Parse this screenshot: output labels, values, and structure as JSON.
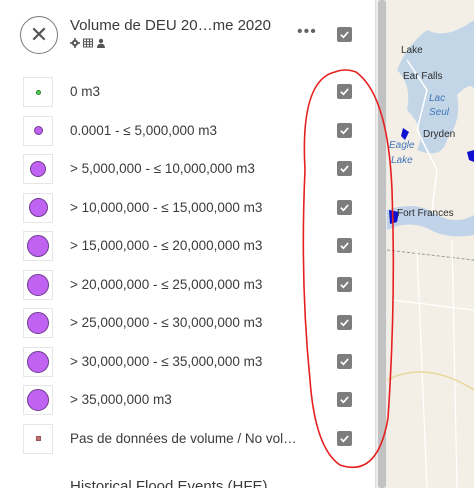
{
  "layer": {
    "title": "Volume de DEU 20…me 2020",
    "tool_icons": [
      "gear-icon",
      "table-icon",
      "person-icon"
    ],
    "more_label": "•••",
    "close_label": "✕",
    "checked": true
  },
  "legend": {
    "items": [
      {
        "label": "0 m3",
        "symbol": "dot",
        "fill": "#4bd84b",
        "checked": true
      },
      {
        "label": "0.0001 - ≤ 5,000,000 m3",
        "symbol": "dot",
        "fill": "#c062f2",
        "checked": true
      },
      {
        "label": "> 5,000,000 - ≤ 10,000,000 m3",
        "symbol": "dot",
        "fill": "#c062f2",
        "checked": true
      },
      {
        "label": "> 10,000,000 - ≤ 15,000,000 m3",
        "symbol": "dot",
        "fill": "#c062f2",
        "checked": true
      },
      {
        "label": "> 15,000,000 - ≤ 20,000,000 m3",
        "symbol": "dot",
        "fill": "#c062f2",
        "checked": true
      },
      {
        "label": "> 20,000,000 - ≤ 25,000,000 m3",
        "symbol": "dot",
        "fill": "#c062f2",
        "checked": true
      },
      {
        "label": "> 25,000,000 - ≤ 30,000,000 m3",
        "symbol": "dot",
        "fill": "#c062f2",
        "checked": true
      },
      {
        "label": "> 30,000,000 - ≤ 35,000,000 m3",
        "symbol": "dot",
        "fill": "#c062f2",
        "checked": true
      },
      {
        "label": "> 35,000,000 m3",
        "symbol": "dot",
        "fill": "#c062f2",
        "checked": true
      },
      {
        "label": "Pas de données de volume / No vol…",
        "symbol": "square",
        "fill": "#c07070",
        "checked": true
      }
    ]
  },
  "next_layer": {
    "title": "Historical Flood Events (HFE)"
  },
  "map": {
    "labels": [
      "Lake",
      "Ear Falls",
      "Lac",
      "Seul",
      "Dryden",
      "Eagle",
      "Lake",
      "Fort Frances"
    ]
  },
  "colors": {
    "annotation": "#e52020",
    "symbol_purple": "#c062f2",
    "checkbox": "#7d7d7d"
  }
}
